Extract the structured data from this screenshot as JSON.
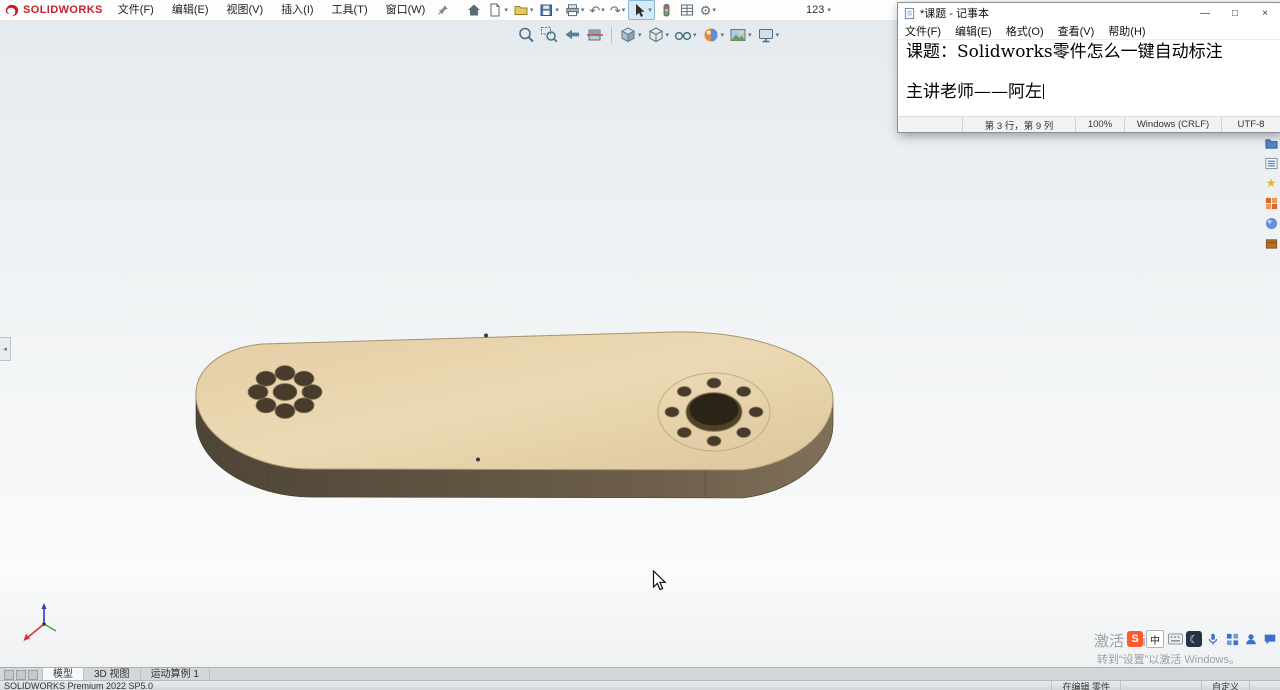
{
  "app": {
    "brand": "SOLIDWORKS",
    "menus": [
      "文件(F)",
      "编辑(E)",
      "视图(V)",
      "插入(I)",
      "工具(T)",
      "窗口(W)"
    ],
    "quick_label": "123",
    "tabs": [
      "模型",
      "3D 视图",
      "运动算例 1"
    ]
  },
  "statusbar": {
    "product": "SOLIDWORKS Premium 2022 SP5.0",
    "editing": "在编辑 零件",
    "customize": "自定义"
  },
  "notepad": {
    "title": "*课题 - 记事本",
    "menus": [
      "文件(F)",
      "编辑(E)",
      "格式(O)",
      "查看(V)",
      "帮助(H)"
    ],
    "lines": [
      "课题：Solidworks零件怎么一键自动标注",
      "",
      "主讲老师——阿左"
    ],
    "status": {
      "line_col": "第 3 行，第 9 列",
      "zoom": "100%",
      "eol": "Windows (CRLF)",
      "encoding": "UTF-8"
    },
    "buttons": {
      "minimize": "—",
      "maximize": "□",
      "close": "×"
    }
  },
  "watermark": {
    "line1": "激活 Windows",
    "line2": "转到“设置”以激活 Windows。"
  },
  "icons": {
    "caret": "▾",
    "undo": "↶",
    "redo": "↷",
    "gear": "⚙",
    "left_collapse": "◂",
    "moon": "☾",
    "sogou": "S",
    "zh": "中",
    "star": "★"
  },
  "colors": {
    "brand_red": "#c8202f",
    "part_top": "#e8d4ab",
    "part_side": "#5d5140",
    "viewport_top": "#e5eaee",
    "tool_active_bg": "#d5e9f7"
  }
}
